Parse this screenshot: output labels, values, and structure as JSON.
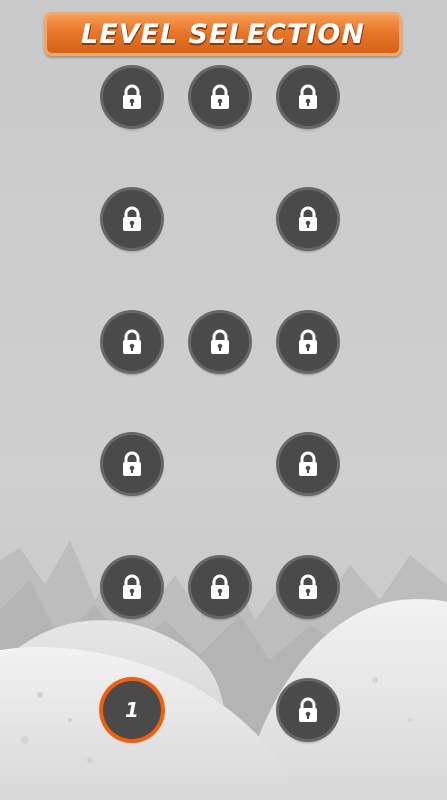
{
  "header": {
    "title": "LEVEL SELECTION"
  },
  "colors": {
    "banner": "#e9772a",
    "background": "#cbcbcb",
    "button": "#4a4a4a",
    "unlocked_ring": "#f06010"
  },
  "levels": [
    {
      "state": "locked",
      "icon": "lock-icon"
    },
    {
      "state": "locked",
      "icon": "lock-icon"
    },
    {
      "state": "locked",
      "icon": "lock-icon"
    },
    {
      "state": "locked",
      "icon": "lock-icon"
    },
    {
      "state": "locked",
      "icon": "lock-icon"
    },
    {
      "state": "locked",
      "icon": "lock-icon"
    },
    {
      "state": "locked",
      "icon": "lock-icon"
    },
    {
      "state": "locked",
      "icon": "lock-icon"
    },
    {
      "state": "locked",
      "icon": "lock-icon"
    },
    {
      "state": "locked",
      "icon": "lock-icon"
    },
    {
      "state": "locked",
      "icon": "lock-icon"
    },
    {
      "state": "locked",
      "icon": "lock-icon"
    },
    {
      "state": "locked",
      "icon": "lock-icon"
    },
    {
      "state": "unlocked",
      "label": "1"
    },
    {
      "state": "locked",
      "icon": "lock-icon"
    }
  ]
}
